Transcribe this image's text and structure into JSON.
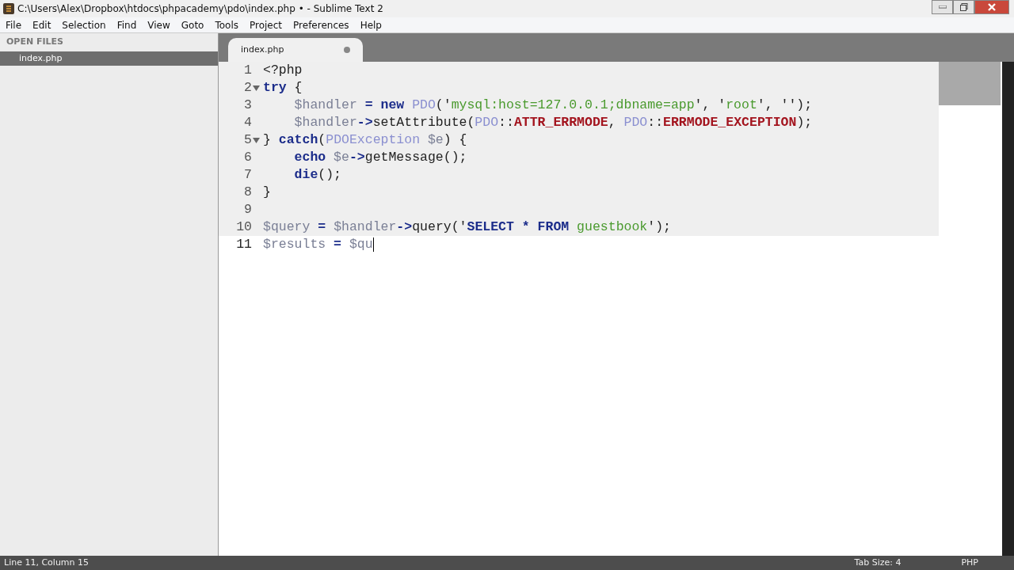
{
  "window": {
    "title": "C:\\Users\\Alex\\Dropbox\\htdocs\\phpacademy\\pdo\\index.php • - Sublime Text 2"
  },
  "menu": [
    "File",
    "Edit",
    "Selection",
    "Find",
    "View",
    "Goto",
    "Tools",
    "Project",
    "Preferences",
    "Help"
  ],
  "sidebar": {
    "header": "OPEN FILES",
    "items": [
      {
        "label": "index.php",
        "selected": true
      }
    ]
  },
  "tabs": [
    {
      "label": "index.php",
      "selected": true,
      "modified": true
    }
  ],
  "editor": {
    "lines": [
      {
        "number": "1",
        "foldable": false,
        "highlighted": true,
        "current": false,
        "indented": false,
        "tokens": [
          {
            "text": "<?php",
            "kind": "plain"
          }
        ]
      },
      {
        "number": "2",
        "foldable": true,
        "highlighted": true,
        "current": false,
        "indented": false,
        "tokens": [
          {
            "text": "try",
            "kind": "keyword"
          },
          {
            "text": " {",
            "kind": "plain"
          }
        ]
      },
      {
        "number": "3",
        "foldable": false,
        "highlighted": true,
        "current": false,
        "indented": true,
        "tokens": [
          {
            "text": "$handler",
            "kind": "variable"
          },
          {
            "text": " =",
            "kind": "operator"
          },
          {
            "text": " new",
            "kind": "keyword"
          },
          {
            "text": " PDO",
            "kind": "class"
          },
          {
            "text": "('",
            "kind": "plain"
          },
          {
            "text": "mysql:host=127.0.0.1;dbname=app",
            "kind": "string"
          },
          {
            "text": "', '",
            "kind": "plain"
          },
          {
            "text": "root",
            "kind": "string"
          },
          {
            "text": "', '');",
            "kind": "plain"
          }
        ]
      },
      {
        "number": "4",
        "foldable": false,
        "highlighted": true,
        "current": false,
        "indented": true,
        "tokens": [
          {
            "text": "$handler",
            "kind": "variable"
          },
          {
            "text": "->",
            "kind": "operator"
          },
          {
            "text": "setAttribute(",
            "kind": "plain"
          },
          {
            "text": "PDO",
            "kind": "class"
          },
          {
            "text": "::",
            "kind": "plain"
          },
          {
            "text": "ATTR_ERRMODE",
            "kind": "constant"
          },
          {
            "text": ", ",
            "kind": "plain"
          },
          {
            "text": "PDO",
            "kind": "class"
          },
          {
            "text": "::",
            "kind": "plain"
          },
          {
            "text": "ERRMODE_EXCEPTION",
            "kind": "constant"
          },
          {
            "text": ");",
            "kind": "plain"
          }
        ]
      },
      {
        "number": "5",
        "foldable": true,
        "highlighted": true,
        "current": false,
        "indented": false,
        "tokens": [
          {
            "text": "} ",
            "kind": "plain"
          },
          {
            "text": "catch",
            "kind": "keyword"
          },
          {
            "text": "(",
            "kind": "plain"
          },
          {
            "text": "PDOException",
            "kind": "class"
          },
          {
            "text": " $e",
            "kind": "variable"
          },
          {
            "text": ") {",
            "kind": "plain"
          }
        ]
      },
      {
        "number": "6",
        "foldable": false,
        "highlighted": true,
        "current": false,
        "indented": true,
        "tokens": [
          {
            "text": "echo",
            "kind": "keyword"
          },
          {
            "text": " $e",
            "kind": "variable"
          },
          {
            "text": "->",
            "kind": "operator"
          },
          {
            "text": "getMessage();",
            "kind": "plain"
          }
        ]
      },
      {
        "number": "7",
        "foldable": false,
        "highlighted": true,
        "current": false,
        "indented": true,
        "tokens": [
          {
            "text": "die",
            "kind": "keyword"
          },
          {
            "text": "();",
            "kind": "plain"
          }
        ]
      },
      {
        "number": "8",
        "foldable": false,
        "highlighted": true,
        "current": false,
        "indented": false,
        "tokens": [
          {
            "text": "}",
            "kind": "plain"
          }
        ]
      },
      {
        "number": "9",
        "foldable": false,
        "highlighted": true,
        "current": false,
        "indented": false
      },
      {
        "number": "10",
        "foldable": false,
        "highlighted": true,
        "current": false,
        "indented": false,
        "tokens": [
          {
            "text": "$query",
            "kind": "variable"
          },
          {
            "text": " =",
            "kind": "operator"
          },
          {
            "text": " $handler",
            "kind": "variable"
          },
          {
            "text": "->",
            "kind": "operator"
          },
          {
            "text": "query('",
            "kind": "plain"
          },
          {
            "text": "SELECT * FROM",
            "kind": "keyword"
          },
          {
            "text": " guestbook",
            "kind": "string"
          },
          {
            "text": "');",
            "kind": "plain"
          }
        ]
      },
      {
        "number": "11",
        "foldable": false,
        "highlighted": false,
        "current": true,
        "indented": false,
        "tokens": [
          {
            "text": "$results",
            "kind": "variable"
          },
          {
            "text": " =",
            "kind": "operator"
          },
          {
            "text": " $qu",
            "kind": "variable"
          }
        ]
      }
    ]
  },
  "status_bar": {
    "position": "Line 11, Column 15",
    "tab_size": "Tab Size: 4",
    "syntax": "PHP"
  }
}
